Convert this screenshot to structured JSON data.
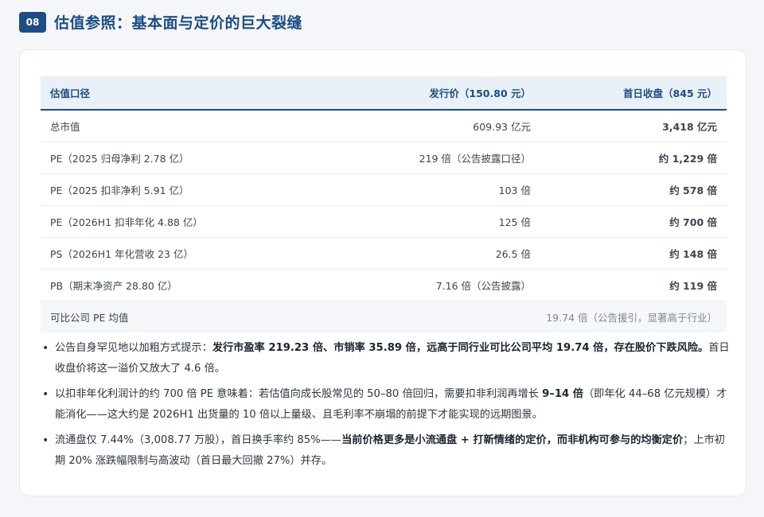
{
  "header": {
    "number": "08",
    "title": "估值参照：基本面与定价的巨大裂缝"
  },
  "table": {
    "headers": [
      "估值口径",
      "发行价（150.80 元）",
      "首日收盘（845 元）"
    ],
    "rows": [
      [
        "总市值",
        "609.93 亿元",
        "3,418 亿元"
      ],
      [
        "PE（2025 归母净利 2.78 亿）",
        "219 倍（公告披露口径）",
        "约 1,229 倍"
      ],
      [
        "PE（2025 扣非净利 5.91 亿）",
        "103 倍",
        "约 578 倍"
      ],
      [
        "PE（2026H1 扣非年化 4.88 亿）",
        "125 倍",
        "约 700 倍"
      ],
      [
        "PS（2026H1 年化营收 23 亿）",
        "26.5 倍",
        "约 148 倍"
      ],
      [
        "PB（期末净资产 28.80 亿）",
        "7.16 倍（公告披露）",
        "约 119 倍"
      ]
    ],
    "last_row": {
      "label": "可比公司 PE 均值",
      "value": "19.74 倍（公告援引，显著高于行业）"
    }
  },
  "notes": [
    {
      "p1": "公告自身罕见地以加粗方式提示：",
      "b1": "发行市盈率 219.23 倍、市销率 35.89 倍，远高于同行业可比公司平均 19.74 倍，存在股价下跌风险。",
      "p2": "首日收盘价将这一溢价又放大了 4.6 倍。",
      "b2": "",
      "p3": ""
    },
    {
      "p1": "以扣非年化利润计的约 700 倍 PE 意味着：若估值向成长股常见的 50–80 倍回归，需要扣非利润再增长 ",
      "b1": "9–14 倍",
      "p2": "（即年化 44–68 亿元规模）才能消化——这大约是 2026H1 出货量的 10 倍以上量级、且毛利率不崩塌的前提下才能实现的远期图景。",
      "b2": "",
      "p3": ""
    },
    {
      "p1": "流通盘仅 7.44%（3,008.77 万股），首日换手率约 85%——",
      "b1": "当前价格更多是小流通盘 + 打新情绪的定价，而非机构可参与的均衡定价",
      "p2": "；上市初期 20% 涨跌幅限制与高波动（首日最大回撤 27%）并存。",
      "b2": "",
      "p3": ""
    }
  ]
}
